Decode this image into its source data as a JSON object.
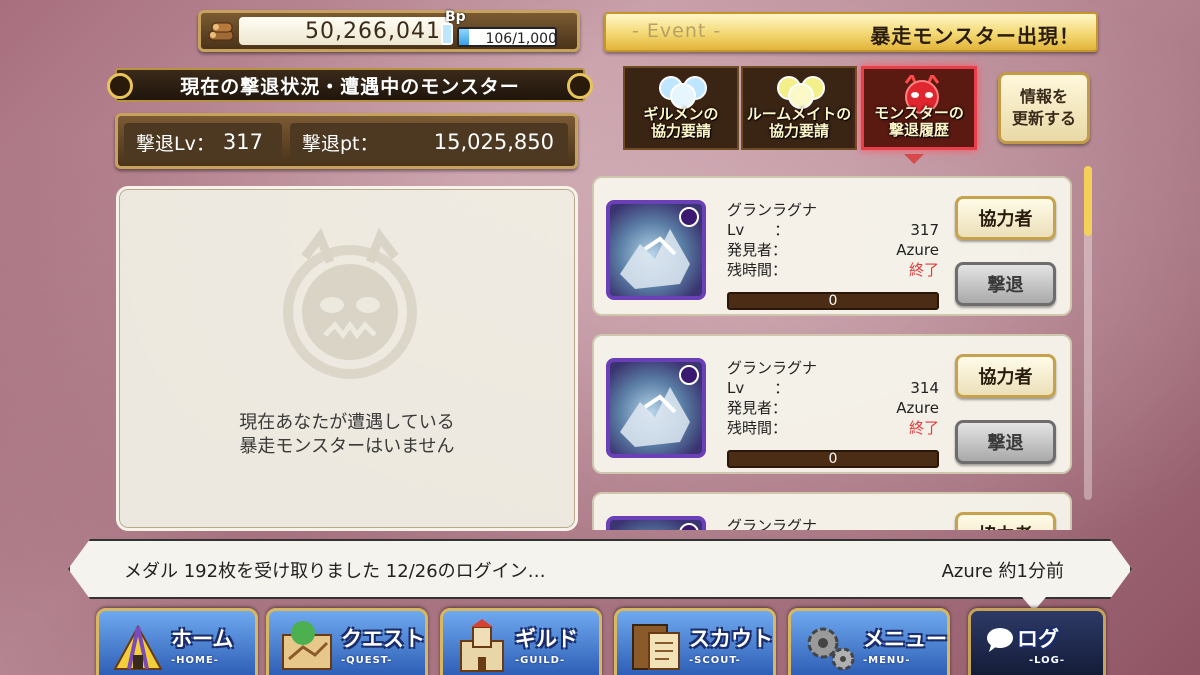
{
  "header": {
    "coins": "50,266,041",
    "bp_label": "Bp",
    "bp_value": "106/1,000",
    "bp_fraction": 0.106
  },
  "status": {
    "title": "現在の撃退状況・遭遇中のモンスター",
    "lv_label": "撃退Lv：",
    "lv_value": "317",
    "pt_label": "撃退pt：",
    "pt_value": "15,025,850"
  },
  "empty_panel": {
    "line1": "現在あなたが遭遇している",
    "line2": "暴走モンスターはいません"
  },
  "event": {
    "tag": "- Event -",
    "title": "暴走モンスター出現！"
  },
  "tabs": [
    {
      "label_line1": "ギルメンの",
      "label_line2": "協力要請"
    },
    {
      "label_line1": "ルームメイトの",
      "label_line2": "協力要請"
    },
    {
      "label_line1": "モンスターの",
      "label_line2": "撃退履歴"
    }
  ],
  "update_button": {
    "line1": "情報を",
    "line2": "更新する"
  },
  "monsters": [
    {
      "name": "グランラグナ",
      "lv_label": "Lv",
      "lv": "317",
      "finder_label": "発見者：",
      "finder": "Azure",
      "time_label": "残時間：",
      "time": "終了",
      "hp": "0",
      "coop_label": "協力者",
      "attack_label": "撃退"
    },
    {
      "name": "グランラグナ",
      "lv_label": "Lv",
      "lv": "314",
      "finder_label": "発見者：",
      "finder": "Azure",
      "time_label": "残時間：",
      "time": "終了",
      "hp": "0",
      "coop_label": "協力者",
      "attack_label": "撃退"
    },
    {
      "name": "グランラグナ",
      "coop_label": "協力者"
    }
  ],
  "ticker": {
    "message": "メダル 192枚を受け取りました 12/26のログイン…",
    "who": "Azure 約1分前"
  },
  "nav": [
    {
      "label": "ホーム",
      "sub": "-HOME-"
    },
    {
      "label": "クエスト",
      "sub": "-QUEST-"
    },
    {
      "label": "ギルド",
      "sub": "-GUILD-"
    },
    {
      "label": "スカウト",
      "sub": "-SCOUT-"
    },
    {
      "label": "メニュー",
      "sub": "-MENU-"
    },
    {
      "label": "ログ",
      "sub": "-LOG-"
    }
  ]
}
